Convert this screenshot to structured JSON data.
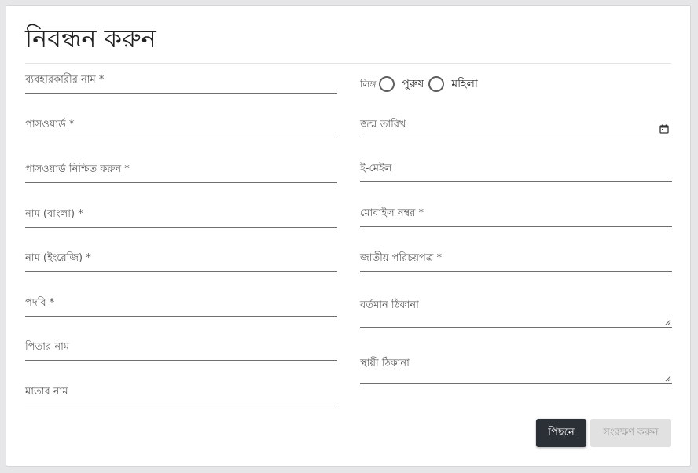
{
  "form": {
    "title": "নিবন্ধন করুন",
    "left_fields": [
      {
        "label": "ব্যবহারকারীর নাম *"
      },
      {
        "label": "পাসওয়ার্ড *"
      },
      {
        "label": "পাসওয়ার্ড নিশ্চিত করুন *"
      },
      {
        "label": "নাম (বাংলা) *"
      },
      {
        "label": "নাম (ইংরেজি) *"
      },
      {
        "label": "পদবি *"
      },
      {
        "label": "পিতার নাম"
      },
      {
        "label": "মাতার নাম"
      }
    ],
    "gender": {
      "label": "লিঙ্গ",
      "options": [
        "পুরুষ",
        "মহিলা"
      ]
    },
    "right_fields": {
      "dob": "জন্ম তারিখ",
      "email": "ই-মেইল",
      "mobile": "মোবাইল নম্বর *",
      "nid": "জাতীয় পরিচয়পত্র *",
      "present_address": "বর্তমান ঠিকানা",
      "permanent_address": "স্থায়ী ঠিকানা"
    },
    "buttons": {
      "back": "পিছনে",
      "save": "সংরক্ষণ করুন"
    }
  }
}
